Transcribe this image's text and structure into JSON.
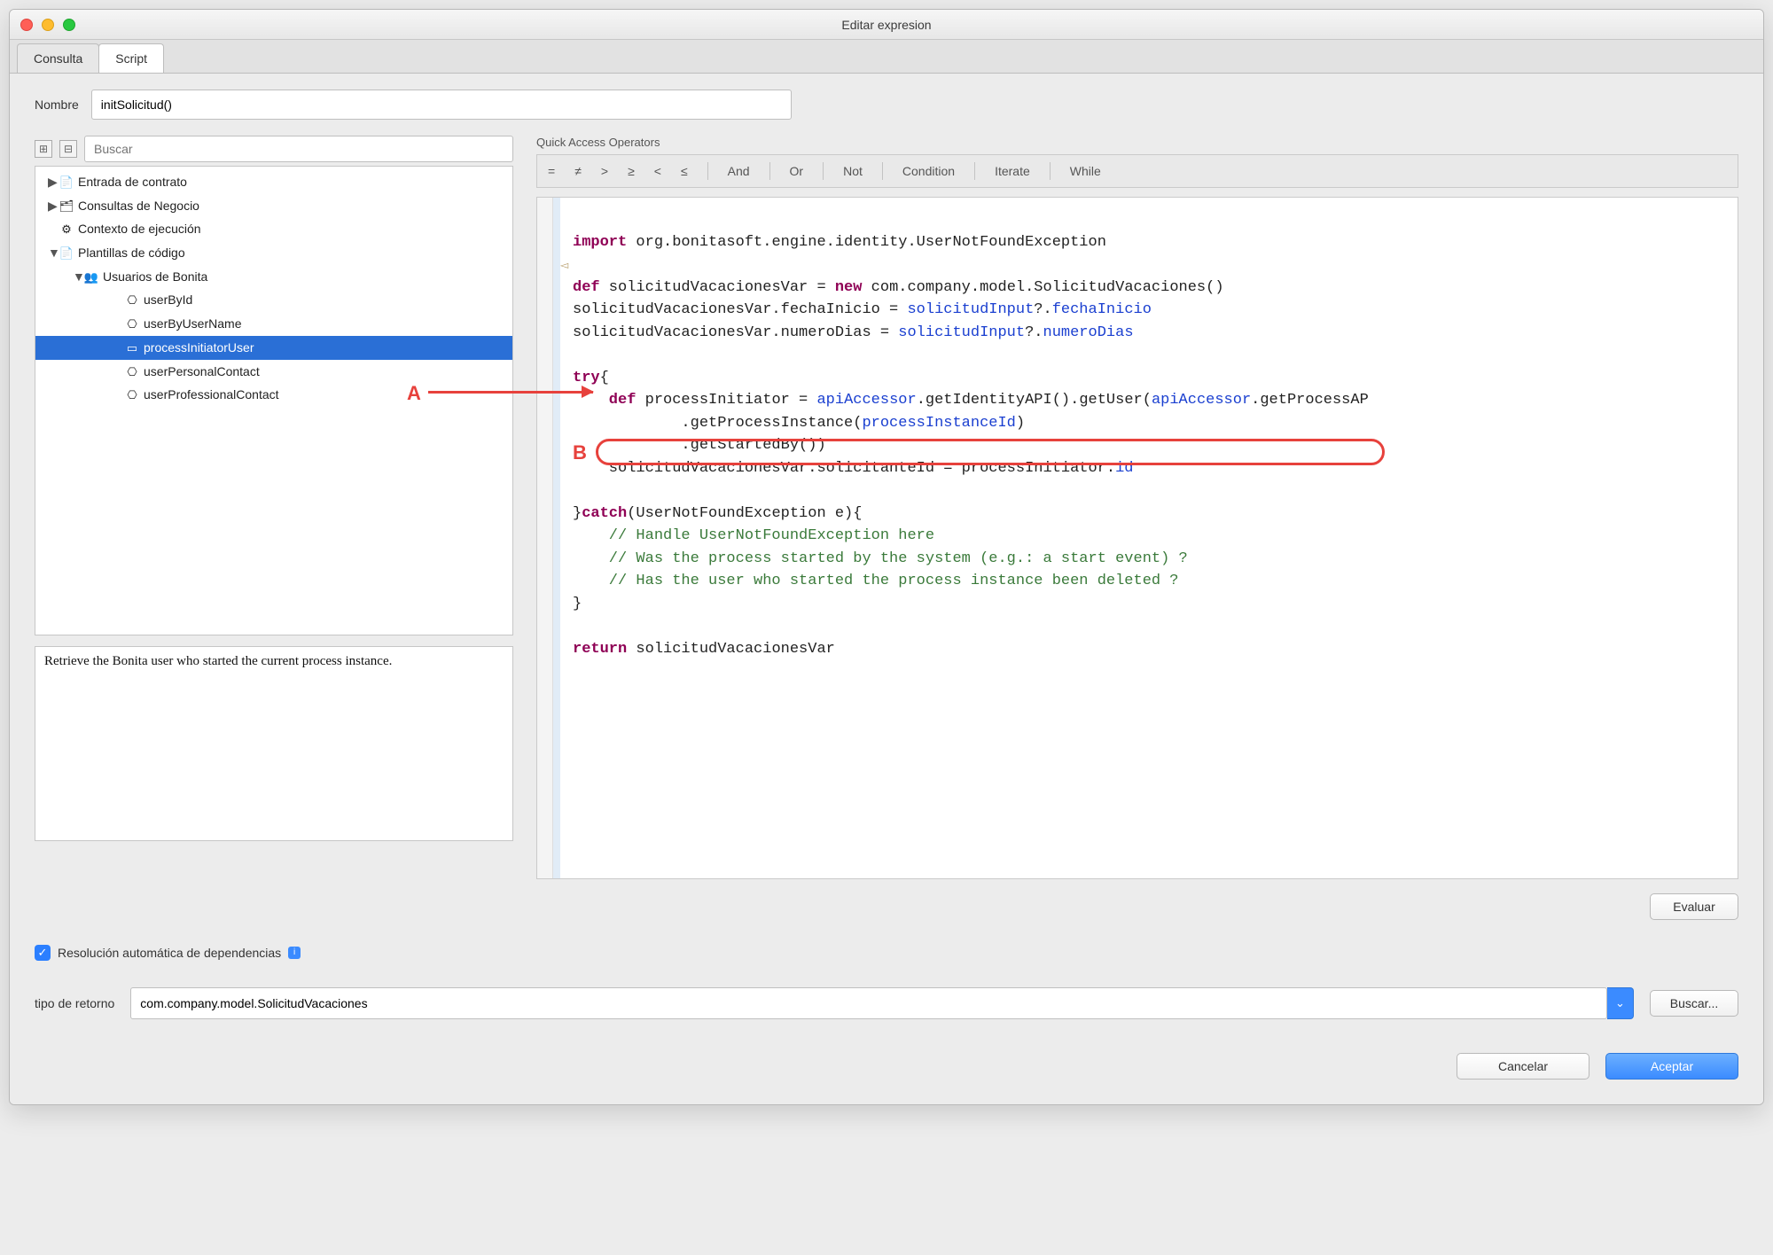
{
  "window": {
    "title": "Editar expresion"
  },
  "tabs": {
    "consulta": "Consulta",
    "script": "Script",
    "active": "script"
  },
  "name": {
    "label": "Nombre",
    "value": "initSolicitud()"
  },
  "sidebar": {
    "search_placeholder": "Buscar",
    "nodes": [
      {
        "label": "Entrada de contrato",
        "depth": 1,
        "expand": "▶",
        "icon": "📄"
      },
      {
        "label": "Consultas de Negocio",
        "depth": 1,
        "expand": "▶",
        "icon": "🗂"
      },
      {
        "label": "Contexto de ejecución",
        "depth": 1,
        "expand": "",
        "icon": "⚙"
      },
      {
        "label": "Plantillas de código",
        "depth": 1,
        "expand": "▼",
        "icon": "📄"
      },
      {
        "label": "Usuarios de Bonita",
        "depth": 2,
        "expand": "▼",
        "icon": "👥"
      },
      {
        "label": "userById",
        "depth": 3,
        "expand": "",
        "icon": "⎔"
      },
      {
        "label": "userByUserName",
        "depth": 3,
        "expand": "",
        "icon": "⎔"
      },
      {
        "label": "processInitiatorUser",
        "depth": 3,
        "expand": "",
        "icon": "▭",
        "selected": true
      },
      {
        "label": "userPersonalContact",
        "depth": 3,
        "expand": "",
        "icon": "⎔"
      },
      {
        "label": "userProfessionalContact",
        "depth": 3,
        "expand": "",
        "icon": "⎔"
      }
    ],
    "description": "Retrieve the Bonita user who started the current process instance."
  },
  "quick_access": {
    "label": "Quick Access Operators",
    "ops": [
      "=",
      "≠",
      ">",
      "≥",
      "<",
      "≤",
      "And",
      "Or",
      "Not",
      "Condition",
      "Iterate",
      "While"
    ]
  },
  "code": {
    "l1a": "import",
    "l1b": " org.bonitasoft.engine.identity.UserNotFoundException",
    "l3a": "def",
    "l3b": " solicitudVacacionesVar = ",
    "l3c": "new",
    "l3d": " com.company.model.SolicitudVacaciones()",
    "l4a": "solicitudVacacionesVar.fechaInicio = ",
    "l4b": "solicitudInput",
    "l4c": "?.",
    "l4d": "fechaInicio",
    "l5a": "solicitudVacacionesVar.numeroDias = ",
    "l5b": "solicitudInput",
    "l5c": "?.",
    "l5d": "numeroDias",
    "l7a": "try",
    "l7b": "{",
    "l8a": "    def",
    "l8b": " processInitiator = ",
    "l8c": "apiAccessor",
    "l8d": ".getIdentityAPI().getUser(",
    "l8e": "apiAccessor",
    "l8f": ".getProcessAP",
    "l9a": "            .getProcessInstance(",
    "l9b": "processInstanceId",
    "l9c": ")",
    "l10": "            .getStartedBy())",
    "l11a": "    solicitudVacacionesVar.solicitanteId = processInitiator.",
    "l11b": "id",
    "l13a": "}",
    "l13b": "catch",
    "l13c": "(UserNotFoundException e){",
    "l14": "    // Handle UserNotFoundException here",
    "l15": "    // Was the process started by the system (e.g.: a start event) ?",
    "l16": "    // Has the user who started the process instance been deleted ?",
    "l17": "}",
    "l19a": "return",
    "l19b": " solicitudVacacionesVar"
  },
  "annotations": {
    "A": "A",
    "B": "B"
  },
  "buttons": {
    "evaluate": "Evaluar",
    "search": "Buscar...",
    "cancel": "Cancelar",
    "accept": "Aceptar"
  },
  "checkbox": {
    "label": "Resolución automática de dependencias",
    "checked": true
  },
  "return": {
    "label": "tipo de retorno",
    "value": "com.company.model.SolicitudVacaciones"
  }
}
